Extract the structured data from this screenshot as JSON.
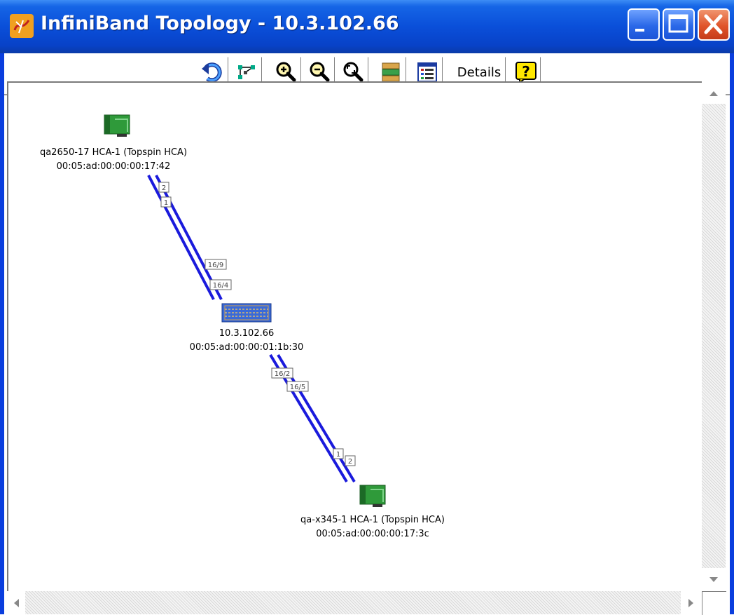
{
  "window": {
    "title": "InfiniBand Topology - 10.3.102.66"
  },
  "toolbar": {
    "items": [
      {
        "name": "back",
        "icon": "undo-arrow-icon"
      },
      {
        "name": "fit",
        "icon": "fit-graph-icon"
      },
      {
        "name": "zoom-in",
        "icon": "zoom-in-icon"
      },
      {
        "name": "zoom-out",
        "icon": "zoom-out-icon"
      },
      {
        "name": "zoom-select",
        "icon": "zoom-region-icon"
      },
      {
        "name": "layout",
        "icon": "layout-icon"
      },
      {
        "name": "legend",
        "icon": "legend-list-icon"
      }
    ],
    "details_label": "Details",
    "help_icon": "help-icon"
  },
  "topology": {
    "nodes": [
      {
        "id": "hca1",
        "type": "hca",
        "name": "qa2650-17 HCA-1 (Topspin HCA)",
        "guid": "00:05:ad:00:00:00:17:42"
      },
      {
        "id": "switch",
        "type": "switch",
        "name": "10.3.102.66",
        "guid": "00:05:ad:00:00:01:1b:30"
      },
      {
        "id": "hca2",
        "type": "hca",
        "name": "qa-x345-1 HCA-1 (Topspin HCA)",
        "guid": "00:05:ad:00:00:00:17:3c"
      }
    ],
    "links": [
      {
        "from_port": "2",
        "to_port": "16/9"
      },
      {
        "from_port": "1",
        "to_port": "16/4"
      },
      {
        "from_port": "16/2",
        "to_port": "1"
      },
      {
        "from_port": "16/5",
        "to_port": "2"
      }
    ]
  },
  "colors": {
    "link": "#1a1adc",
    "titlebar": "#0a4fd9",
    "hca_card": "#2f9a3a"
  }
}
